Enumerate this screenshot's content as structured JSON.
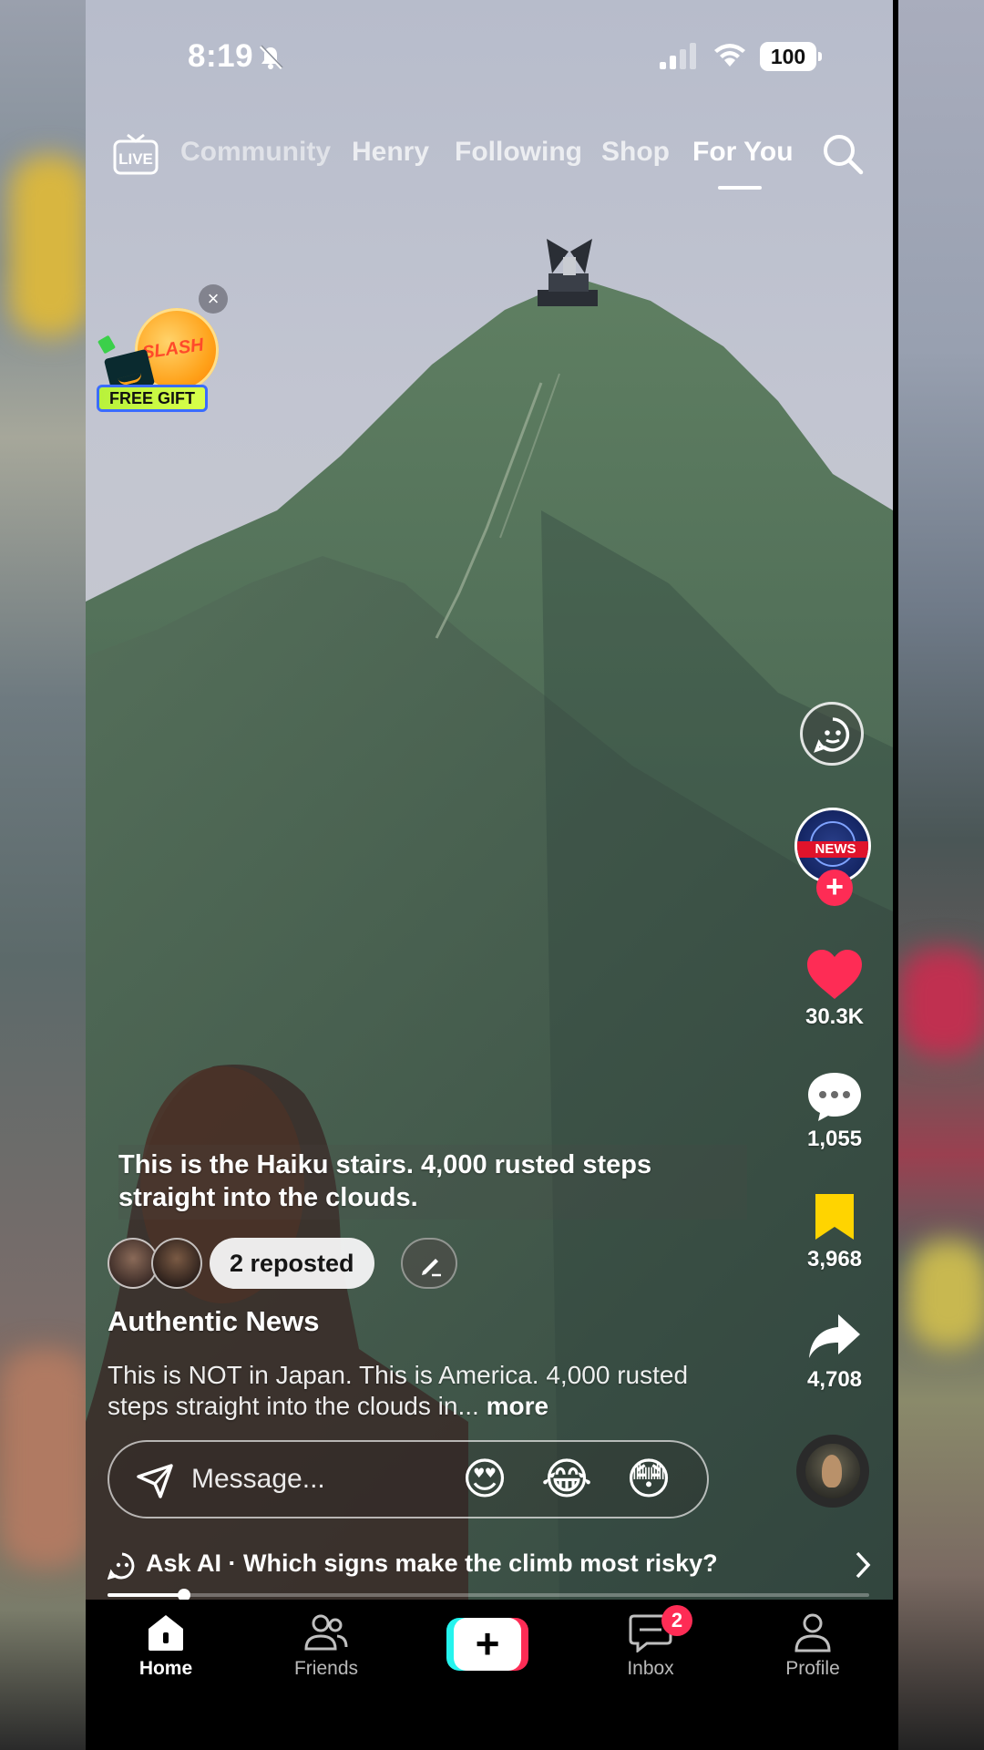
{
  "status_bar": {
    "time": "8:19",
    "battery": "100"
  },
  "top_nav": {
    "tabs": [
      {
        "label": "Community"
      },
      {
        "label": "Henry"
      },
      {
        "label": "Following"
      },
      {
        "label": "Shop"
      },
      {
        "label": "For You"
      }
    ],
    "active_tab": "For You"
  },
  "promo": {
    "badge": "SLASH",
    "label": "FREE GIFT"
  },
  "creator": {
    "avatar_text": "NEWS",
    "name": "Authentic News"
  },
  "actions": {
    "likes": "30.3K",
    "comments": "1,055",
    "saves": "3,968",
    "shares": "4,708"
  },
  "video": {
    "overlay_caption": "This is the Haiku stairs. 4,000 rusted steps straight into the clouds.",
    "reposted_label": "2 reposted",
    "description": "This is NOT in Japan. This is America. 4,000 rusted steps straight into the clouds in...",
    "more_label": "more",
    "progress": 0.1
  },
  "message_bar": {
    "placeholder": "Message...",
    "emojis": [
      "😍",
      "😂",
      "😳"
    ]
  },
  "ask_ai": {
    "text": "Ask AI · Which signs make the climb most risky?"
  },
  "bottom_nav": {
    "items": [
      {
        "label": "Home"
      },
      {
        "label": "Friends"
      },
      {
        "label": "Inbox",
        "badge": "2"
      },
      {
        "label": "Profile"
      }
    ]
  },
  "colors": {
    "accent_red": "#fe2c55",
    "accent_cyan": "#25f4ee",
    "save_yellow": "#ffd400"
  }
}
